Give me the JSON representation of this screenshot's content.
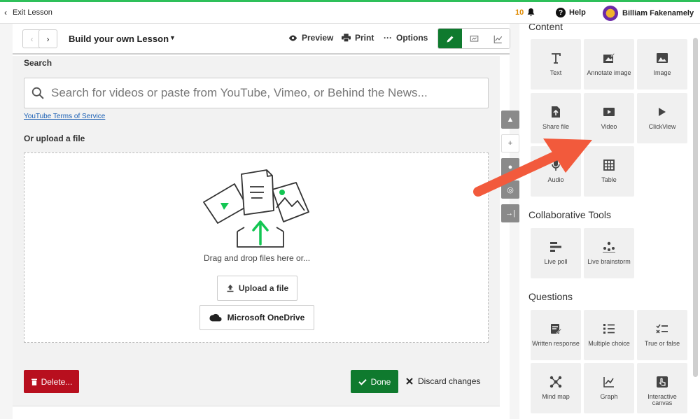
{
  "topbar": {
    "exit_label": "Exit Lesson",
    "notif_count": "10",
    "help_label": "Help",
    "user_name": "Billiam Fakenamely"
  },
  "toolbar": {
    "lesson_title": "Build your own Lesson",
    "preview_label": "Preview",
    "print_label": "Print",
    "options_label": "Options"
  },
  "editor": {
    "search_label": "Search",
    "search_placeholder": "Search for videos or paste from YouTube, Vimeo, or Behind the News...",
    "tos_link": "YouTube Terms of Service",
    "upload_label": "Or upload a file",
    "drag_text": "Drag and drop files here or...",
    "upload_button": "Upload a file",
    "onedrive_button": "Microsoft OneDrive",
    "delete_button": "Delete...",
    "done_button": "Done",
    "discard_button": "Discard changes"
  },
  "palette": {
    "content_title": "Content",
    "content_items": [
      {
        "label": "Text",
        "icon": "text-icon"
      },
      {
        "label": "Annotate image",
        "icon": "annotate-icon"
      },
      {
        "label": "Image",
        "icon": "image-icon"
      },
      {
        "label": "Share file",
        "icon": "share-file-icon"
      },
      {
        "label": "Video",
        "icon": "video-icon"
      },
      {
        "label": "ClickView",
        "icon": "clickview-icon"
      },
      {
        "label": "Audio",
        "icon": "audio-icon"
      },
      {
        "label": "Table",
        "icon": "table-icon"
      }
    ],
    "collab_title": "Collaborative Tools",
    "collab_items": [
      {
        "label": "Live poll",
        "icon": "poll-icon"
      },
      {
        "label": "Live brainstorm",
        "icon": "brainstorm-icon"
      }
    ],
    "questions_title": "Questions",
    "question_items": [
      {
        "label": "Written response",
        "icon": "written-icon"
      },
      {
        "label": "Multiple choice",
        "icon": "multiple-choice-icon"
      },
      {
        "label": "True or false",
        "icon": "true-false-icon"
      },
      {
        "label": "Mind map",
        "icon": "mind-map-icon"
      },
      {
        "label": "Graph",
        "icon": "graph-icon"
      },
      {
        "label": "Interactive canvas",
        "icon": "canvas-icon"
      }
    ]
  },
  "colors": {
    "accent_green": "#0f7a2e",
    "delete_red": "#b80f1e",
    "arrow": "#f25a3c",
    "top_line": "#2ec05a"
  }
}
